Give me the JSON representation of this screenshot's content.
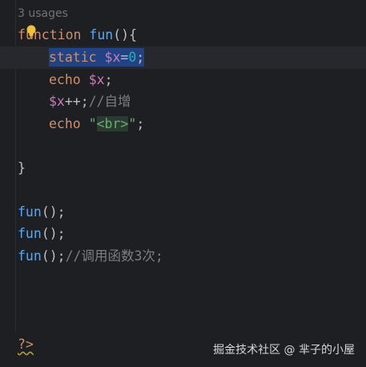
{
  "editor": {
    "usages_hint": "3 usages",
    "lines": {
      "l1": {
        "kw": "function",
        "name": "fun",
        "rest": "(){"
      },
      "l2": {
        "kw": "static",
        "var": "$x",
        "op": "=",
        "num": "0",
        "end": ";"
      },
      "l3": {
        "kw": "echo",
        "var": "$x",
        "end": ";"
      },
      "l4": {
        "var": "$x",
        "op": "++;",
        "comment": "//自增"
      },
      "l5": {
        "kw": "echo",
        "q1": "\"",
        "tag": "<br>",
        "q2": "\"",
        "end": ";"
      },
      "l7": {
        "brace": "}"
      },
      "l9": {
        "name": "fun",
        "rest": "();"
      },
      "l10": {
        "name": "fun",
        "rest": "();"
      },
      "l11": {
        "name": "fun",
        "rest": "();",
        "comment": "//调用函数3次;"
      },
      "l15": {
        "phptag": "?>"
      }
    }
  },
  "watermark": "掘金技术社区 @ 芈子的小屋",
  "colors": {
    "background": "#1e1f22",
    "keyword": "#cf8e6d",
    "function": "#56a8f5",
    "variable": "#c77dbb",
    "number": "#2aacb8",
    "string": "#6aab73",
    "comment": "#7a7e85",
    "selection": "#214283"
  },
  "icons": {
    "intention": "lightbulb-icon"
  }
}
